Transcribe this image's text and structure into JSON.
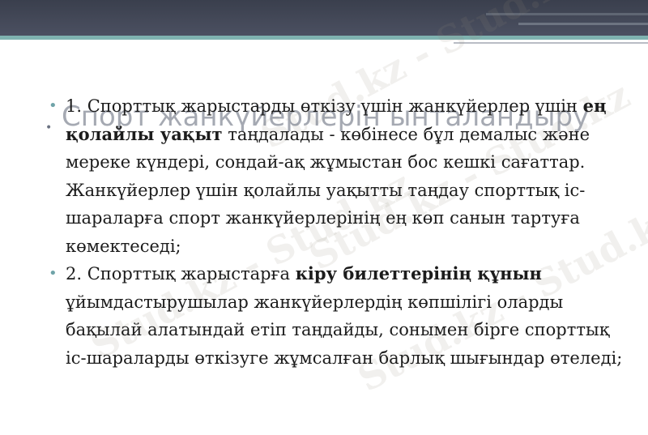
{
  "slide": {
    "title": "Спорт жанкүйерлерін ынталандыру",
    "bullet_char": "•",
    "watermark_text": "Stud.kz - Stud.kz",
    "items": [
      {
        "before": "1. Спорттық жарыстарды өткізу үшін жанкүйерлер үшін ",
        "bold": "ең қолайлы уақыт",
        "after": " таңдалады - көбінесе бұл демалыс және мереке күндері, сондай-ақ жұмыстан бос кешкі сағаттар. Жанкүйерлер үшін қолайлы уақытты таңдау спорттық іс-шараларға спорт жанкүйерлерінің ең көп санын тартуға көмектеседі;"
      },
      {
        "before": "2. Спорттық жарыстарға ",
        "bold": "кіру билеттерінің құнын",
        "after": " ұйымдастырушылар жанкүйерлердің көпшілігі оларды бақылай алатындай етіп таңдайды, сонымен бірге спорттық іс-шараларды өткізуге жұмсалған барлық шығындар өтеледі;"
      }
    ]
  },
  "colors": {
    "topbar": "#3a3f4d",
    "accent_teal": "#7fb3b0",
    "bullet": "#6fa3a8",
    "title": "#6a7180",
    "text": "#1c1c1c"
  }
}
